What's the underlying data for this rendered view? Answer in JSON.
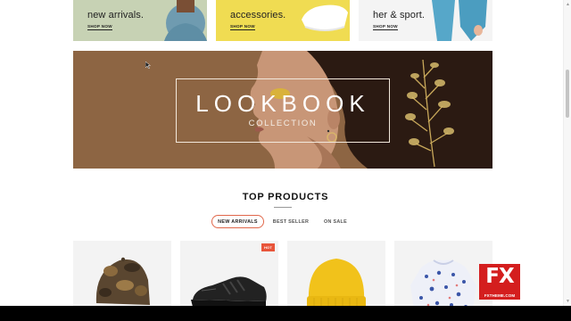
{
  "categories": [
    {
      "title": "new arrivals.",
      "link": "SHOP NOW",
      "color": "#c7d2b4"
    },
    {
      "title": "accessories.",
      "link": "SHOP NOW",
      "color": "#f0dc52"
    },
    {
      "title": "her & sport.",
      "link": "SHOP NOW",
      "color": "#f4f4f4"
    }
  ],
  "lookbook": {
    "title": "LOOKBOOK",
    "subtitle": "COLLECTION",
    "background": "#8d6543"
  },
  "section": {
    "title": "TOP PRODUCTS"
  },
  "tabs": [
    {
      "label": "NEW ARRIVALS",
      "active": true
    },
    {
      "label": "BEST SELLER",
      "active": false
    },
    {
      "label": "ON SALE",
      "active": false
    }
  ],
  "products": [
    {
      "image": "camo-cap"
    },
    {
      "image": "black-sneaker",
      "badge": "HOT"
    },
    {
      "image": "yellow-beanie"
    },
    {
      "image": "floral-sweater"
    }
  ],
  "watermark": {
    "logo": "FX",
    "site": "FXTHEME.COM"
  },
  "colors": {
    "accent": "#e8553a",
    "tab_border": "#e0674a"
  }
}
